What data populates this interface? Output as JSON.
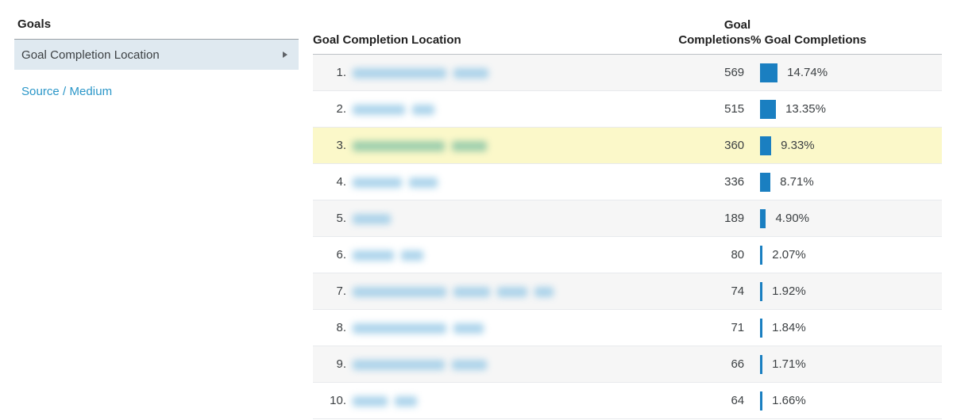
{
  "sidebar": {
    "title": "Goals",
    "items": [
      {
        "label": "Goal Completion Location",
        "selected": true,
        "has_caret": true
      },
      {
        "label": "Source / Medium",
        "selected": false,
        "has_caret": false
      }
    ]
  },
  "table": {
    "columns": {
      "dimension": "Goal Completion Location",
      "goal_completions": "Goal\nCompletions",
      "goal_completions_line1": "Goal",
      "goal_completions_line2": "Completions",
      "pct_goal_completions": "% Goal Completions"
    },
    "accent_color": "#1a7fc1",
    "highlight_color": "#fbf8c9",
    "stripe_color": "#f6f6f6",
    "rows": [
      {
        "index": "1.",
        "label": "",
        "redacted": true,
        "redacted_widths": [
          118,
          44
        ],
        "goal_completions": "569",
        "pct": "14.74%",
        "pct_value": 14.74
      },
      {
        "index": "2.",
        "label": "",
        "redacted": true,
        "redacted_widths": [
          66,
          28
        ],
        "goal_completions": "515",
        "pct": "13.35%",
        "pct_value": 13.35
      },
      {
        "index": "3.",
        "label": "",
        "redacted": true,
        "redacted_widths": [
          116,
          44
        ],
        "goal_completions": "360",
        "pct": "9.33%",
        "pct_value": 9.33,
        "highlighted": true
      },
      {
        "index": "4.",
        "label": "",
        "redacted": true,
        "redacted_widths": [
          62,
          36
        ],
        "goal_completions": "336",
        "pct": "8.71%",
        "pct_value": 8.71
      },
      {
        "index": "5.",
        "label": "",
        "redacted": true,
        "redacted_widths": [
          48
        ],
        "goal_completions": "189",
        "pct": "4.90%",
        "pct_value": 4.9
      },
      {
        "index": "6.",
        "label": "",
        "redacted": true,
        "redacted_widths": [
          52,
          28
        ],
        "goal_completions": "80",
        "pct": "2.07%",
        "pct_value": 2.07
      },
      {
        "index": "7.",
        "label": "",
        "redacted": true,
        "redacted_widths": [
          118,
          46,
          38,
          24
        ],
        "goal_completions": "74",
        "pct": "1.92%",
        "pct_value": 1.92
      },
      {
        "index": "8.",
        "label": "",
        "redacted": true,
        "redacted_widths": [
          118,
          38
        ],
        "goal_completions": "71",
        "pct": "1.84%",
        "pct_value": 1.84
      },
      {
        "index": "9.",
        "label": "",
        "redacted": true,
        "redacted_widths": [
          116,
          44
        ],
        "goal_completions": "66",
        "pct": "1.71%",
        "pct_value": 1.71
      },
      {
        "index": "10.",
        "label": "",
        "redacted": true,
        "redacted_widths": [
          44,
          28
        ],
        "goal_completions": "64",
        "pct": "1.66%",
        "pct_value": 1.66
      }
    ]
  },
  "chart_data": {
    "type": "bar",
    "title": "Goal Completion Location",
    "xlabel": "",
    "ylabel": "% Goal Completions",
    "categories": [
      "1.",
      "2.",
      "3.",
      "4.",
      "5.",
      "6.",
      "7.",
      "8.",
      "9.",
      "10."
    ],
    "series": [
      {
        "name": "Goal Completions",
        "values": [
          569,
          515,
          360,
          336,
          189,
          80,
          74,
          71,
          66,
          64
        ]
      },
      {
        "name": "% Goal Completions",
        "values": [
          14.74,
          13.35,
          9.33,
          8.71,
          4.9,
          2.07,
          1.92,
          1.84,
          1.71,
          1.66
        ]
      }
    ],
    "grid": false,
    "legend": "none"
  }
}
